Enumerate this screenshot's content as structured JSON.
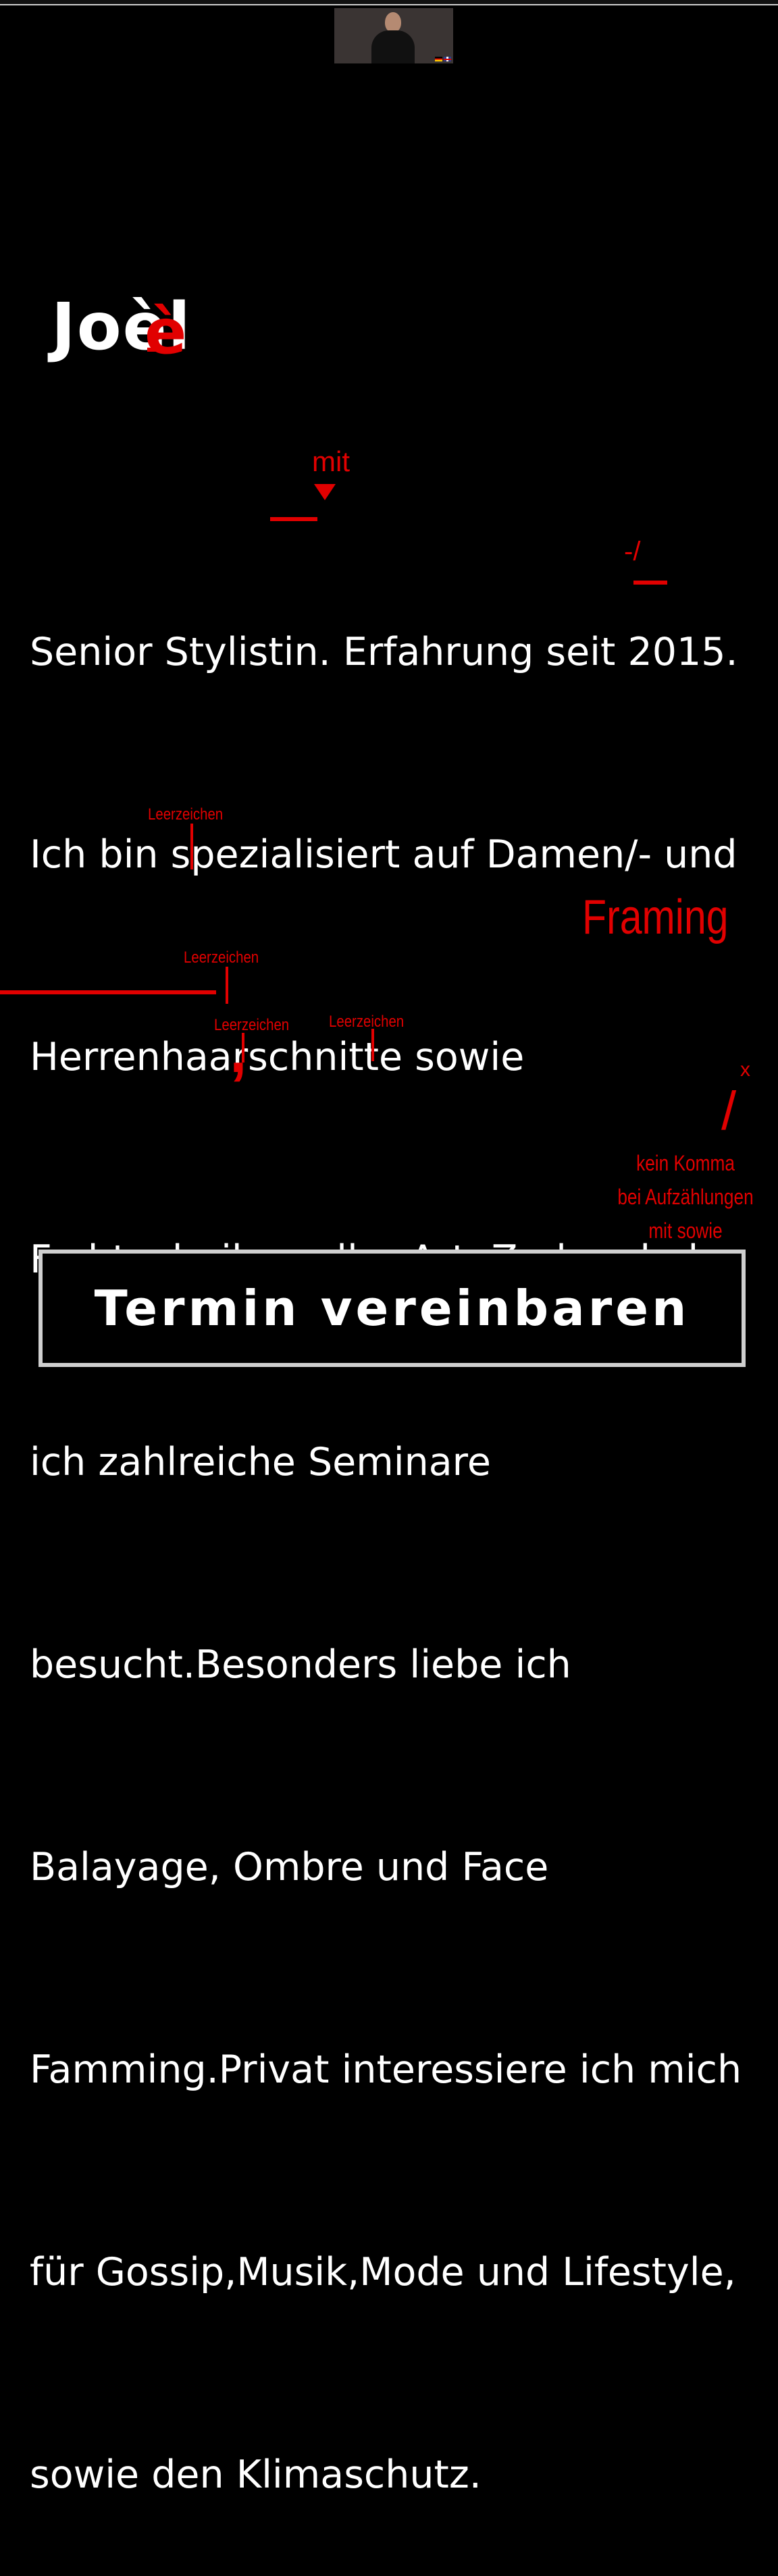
{
  "profile": {
    "name": "Joèl",
    "name_correction": "è",
    "bio_lines": [
      "Senior Stylistin. Erfahrung seit 2015.",
      "Ich bin spezialisiert auf Damen/- und",
      "Herrenhaarschnitte sowie",
      "Farbtechniken aller Art. Zudem habe",
      "ich zahlreiche Seminare",
      "besucht.Besonders liebe ich",
      "Balayage, Ombre und Face",
      "Famming.Privat interessiere ich mich",
      "für Gossip,Musik,Mode und Lifestyle,",
      "sowie den Klimaschutz."
    ]
  },
  "annotations": {
    "mit": "mit",
    "dash_slash": "-/",
    "leerzeichen": "Leerzeichen",
    "framing": "Framing",
    "comma": ",",
    "x_mark": "x",
    "slash": "/",
    "kein_komma": [
      "kein Komma",
      "bei Aufzählungen",
      "mit sowie"
    ]
  },
  "cta": {
    "label": "Termin vereinbaren"
  },
  "colors": {
    "background": "#000000",
    "text": "#ffffff",
    "annotation": "#e10000",
    "button_border": "#cfcfcf"
  }
}
